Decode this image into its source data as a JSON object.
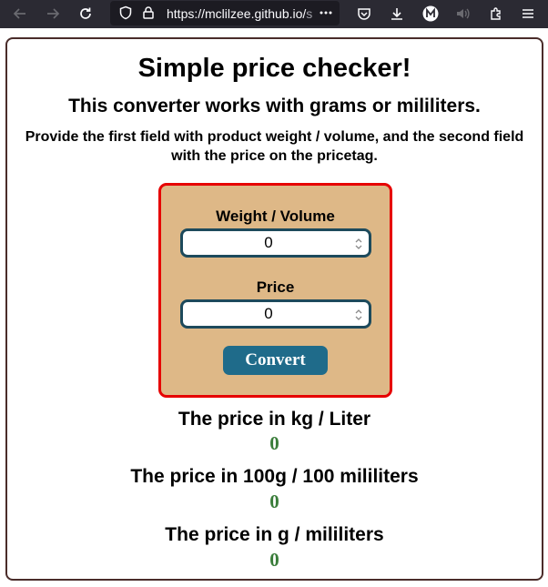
{
  "browser": {
    "url_main": "https://mclilzee.github.io/",
    "url_rest": "s"
  },
  "page": {
    "title": "Simple price checker!",
    "subtitle": "This converter works with grams or mililiters.",
    "instructions": "Provide the first field with product weight / volume, and the second field with the price on the pricetag."
  },
  "form": {
    "weight_label": "Weight / Volume",
    "weight_value": "0",
    "price_label": "Price",
    "price_value": "0",
    "convert_label": "Convert"
  },
  "results": [
    {
      "label": "The price in kg / Liter",
      "value": "0"
    },
    {
      "label": "The price in 100g / 100 mililiters",
      "value": "0"
    },
    {
      "label": "The price in g / mililiters",
      "value": "0"
    }
  ],
  "colors": {
    "panel_bg": "#deb887",
    "panel_border": "#e60000",
    "button_bg": "#1f6b8a",
    "result_value": "#3a7d3a",
    "page_border": "#4a2c2a"
  }
}
